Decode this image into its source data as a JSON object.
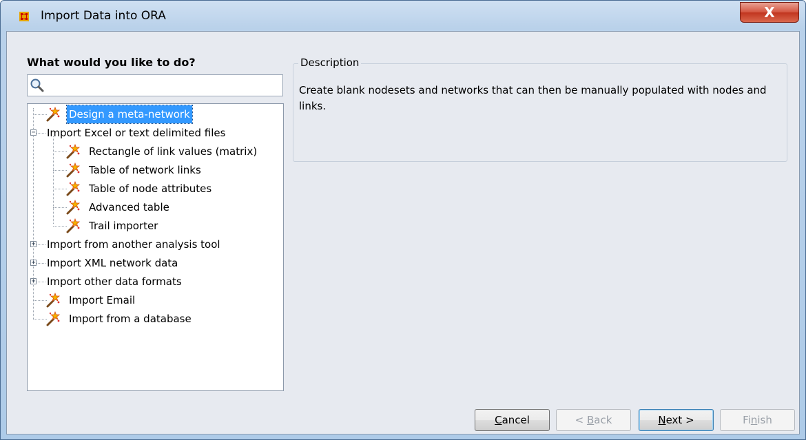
{
  "window": {
    "title": "Import Data into ORA",
    "close_label": "X"
  },
  "left_panel": {
    "heading": "What would you like to do?",
    "search": {
      "value": "",
      "placeholder": ""
    }
  },
  "tree": {
    "items": [
      {
        "label": "Design a meta-network",
        "kind": "leaf",
        "level": 1,
        "selected": true
      },
      {
        "label": "Import Excel or text delimited files",
        "kind": "expanded",
        "level": 1
      },
      {
        "label": "Rectangle of link values (matrix)",
        "kind": "leaf",
        "level": 2
      },
      {
        "label": "Table of network links",
        "kind": "leaf",
        "level": 2
      },
      {
        "label": "Table of node attributes",
        "kind": "leaf",
        "level": 2
      },
      {
        "label": "Advanced table",
        "kind": "leaf",
        "level": 2
      },
      {
        "label": "Trail importer",
        "kind": "leaf",
        "level": 2
      },
      {
        "label": "Import from another analysis tool",
        "kind": "collapsed",
        "level": 1
      },
      {
        "label": "Import XML network data",
        "kind": "collapsed",
        "level": 1
      },
      {
        "label": "Import other data formats",
        "kind": "collapsed",
        "level": 1
      },
      {
        "label": "Import Email",
        "kind": "leaf",
        "level": 1
      },
      {
        "label": "Import from a database",
        "kind": "leaf",
        "level": 1
      }
    ]
  },
  "description": {
    "legend": "Description",
    "text": "Create blank nodesets and networks that can then be manually populated with nodes and links."
  },
  "buttons": {
    "cancel": {
      "label": "Cancel",
      "enabled": true
    },
    "back": {
      "label": "< Back",
      "enabled": false
    },
    "next": {
      "label": "Next >",
      "enabled": true
    },
    "finish": {
      "label": "Finish",
      "enabled": false
    }
  },
  "colors": {
    "selection": "#3399ff",
    "close_button": "#c7432b",
    "app_icon": "#e8a400"
  }
}
